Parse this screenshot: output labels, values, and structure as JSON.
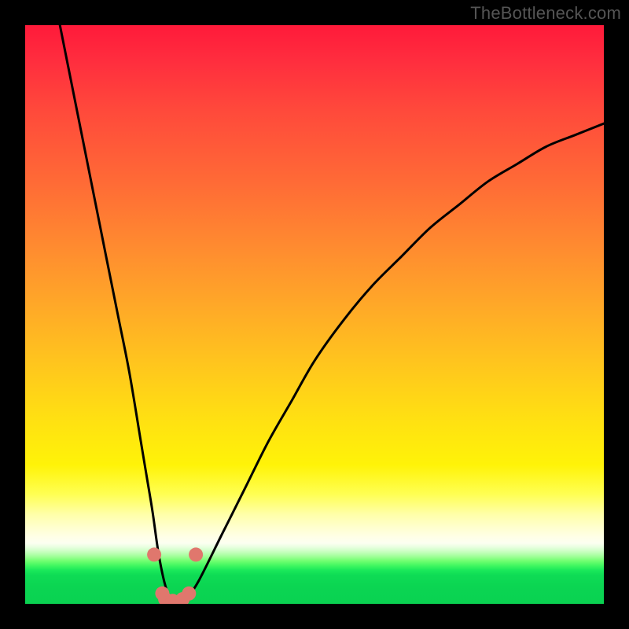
{
  "watermark": "TheBottleneck.com",
  "chart_data": {
    "type": "line",
    "title": "",
    "xlabel": "",
    "ylabel": "",
    "xlim": [
      0,
      100
    ],
    "ylim": [
      0,
      100
    ],
    "series": [
      {
        "name": "bottleneck-curve",
        "x": [
          6,
          8,
          10,
          12,
          14,
          16,
          18,
          20,
          21,
          22,
          23,
          24,
          25,
          26,
          27,
          28,
          30,
          34,
          38,
          42,
          46,
          50,
          55,
          60,
          65,
          70,
          75,
          80,
          85,
          90,
          95,
          100
        ],
        "y": [
          100,
          90,
          80,
          70,
          60,
          50,
          40,
          28,
          22,
          16,
          9,
          4,
          1,
          0,
          0,
          1,
          4,
          12,
          20,
          28,
          35,
          42,
          49,
          55,
          60,
          65,
          69,
          73,
          76,
          79,
          81,
          83
        ]
      }
    ],
    "markers": {
      "name": "dip-points",
      "x": [
        22.3,
        23.7,
        24.2,
        25.5,
        27.2,
        28.3,
        29.5
      ],
      "y": [
        8.5,
        1.8,
        0.8,
        0.5,
        0.8,
        1.8,
        8.5
      ],
      "color": "#e0776d",
      "radius": 9
    },
    "gradient_stops": [
      {
        "pos": 0.0,
        "color": "#ff1a3a"
      },
      {
        "pos": 0.38,
        "color": "#ff8a30"
      },
      {
        "pos": 0.76,
        "color": "#fff308"
      },
      {
        "pos": 0.89,
        "color": "#ffffe8"
      },
      {
        "pos": 0.93,
        "color": "#40f760"
      },
      {
        "pos": 1.0,
        "color": "#0ad251"
      }
    ]
  }
}
